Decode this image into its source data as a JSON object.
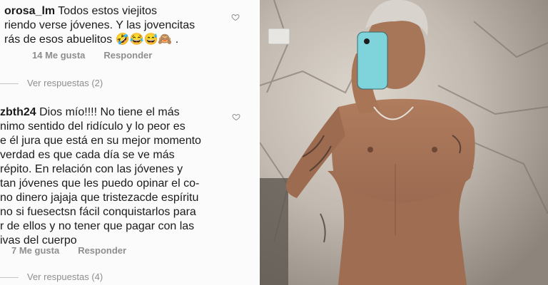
{
  "comments": [
    {
      "user": "orosa_lm",
      "lines": [
        "Todos estos viejitos",
        "riendo verse jóvenes. Y las jovencitas",
        "rás de esos abuelitos 🤣😂😅🙈 ."
      ],
      "likes": "14 Me gusta",
      "reply": "Responder",
      "view_replies": "Ver respuestas (2)"
    },
    {
      "user": "zbth24",
      "lines": [
        "Dios mío!!!! No tiene el más",
        "nimo sentido del ridículo y lo peor es",
        "e él jura que está en su mejor momento",
        "verdad es que cada día se ve más",
        "répito. En relación con las jóvenes y",
        "tan jóvenes que les puedo opinar el co-",
        "no dinero jajaja que tristezacde espíritu",
        "no si fuesectsn fácil conquistarlos para",
        "r de ellos y no tener que pagar con las",
        "ivas del cuerpo"
      ],
      "likes": "7 Me gusta",
      "reply": "Responder",
      "view_replies": "Ver respuestas (4)"
    }
  ],
  "colors": {
    "text": "#1b1b1b",
    "meta": "#8e8e8e",
    "phone_case": "#7fd4dc"
  }
}
